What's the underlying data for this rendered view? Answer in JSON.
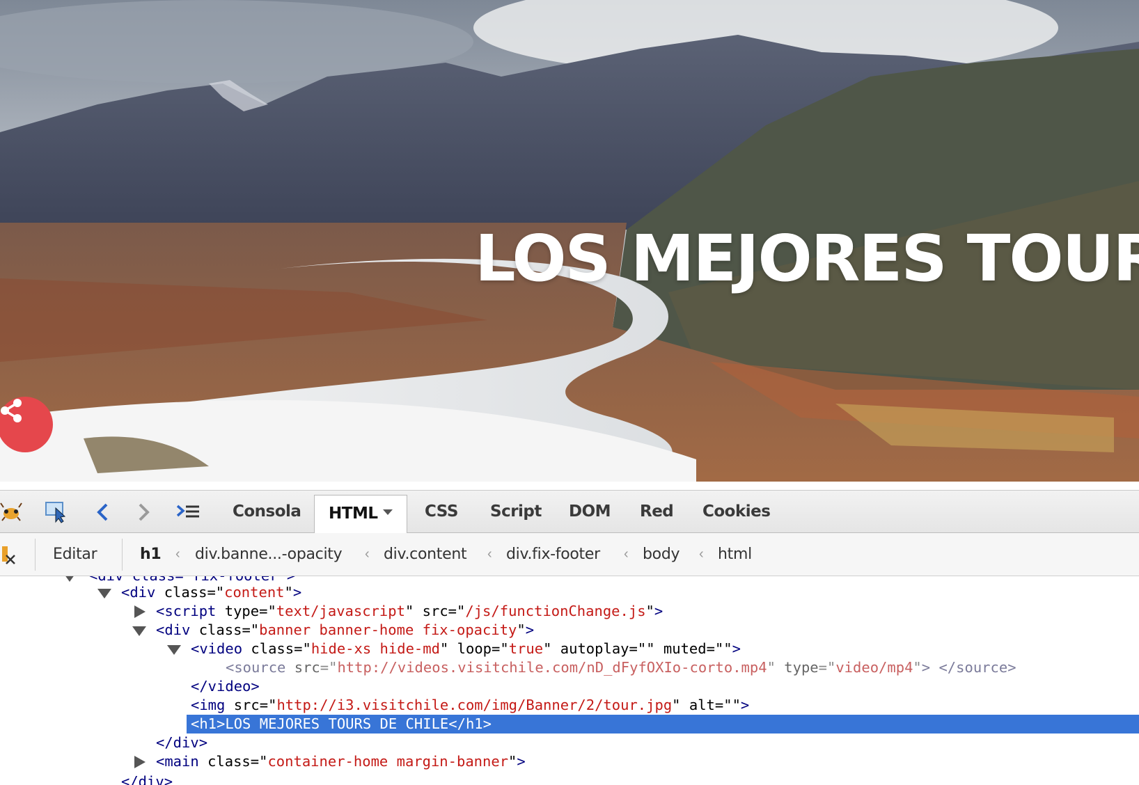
{
  "banner": {
    "title": "LOS MEJORES TOUR",
    "share_icon": "share-icon",
    "accent_color": "#e5474c"
  },
  "devtools": {
    "toolbar": {
      "icons": [
        "firebug-icon",
        "inspect-pointer-icon",
        "back-icon",
        "forward-icon",
        "command-line-icon"
      ],
      "tabs": [
        {
          "label": "Consola",
          "active": false
        },
        {
          "label": "HTML",
          "active": true
        },
        {
          "label": "CSS",
          "active": false
        },
        {
          "label": "Script",
          "active": false
        },
        {
          "label": "DOM",
          "active": false
        },
        {
          "label": "Red",
          "active": false
        },
        {
          "label": "Cookies",
          "active": false
        }
      ]
    },
    "breadcrumbs": {
      "edit_label": "Editar",
      "items": [
        "h1",
        "div.banne...-opacity",
        "div.content",
        "div.fix-footer",
        "body",
        "html"
      ]
    },
    "tree": {
      "partial_top": "<div class=\"fix-footer\">",
      "lines": [
        {
          "tag_open": "<div",
          "attrs": [
            {
              "n": "class",
              "v": "content"
            }
          ],
          "close": ">"
        },
        {
          "tag_open": "<script",
          "attrs": [
            {
              "n": "type",
              "v": "text/javascript"
            },
            {
              "n": "src",
              "v": "/js/functionChange.js"
            }
          ],
          "close": ">"
        },
        {
          "tag_open": "<div",
          "attrs": [
            {
              "n": "class",
              "v": "banner banner-home fix-opacity"
            }
          ],
          "close": ">"
        },
        {
          "tag_open": "<video",
          "attrs": [
            {
              "n": "class",
              "v": "hide-xs hide-md"
            },
            {
              "n": "loop",
              "v": "true"
            },
            {
              "n": "autoplay",
              "v": ""
            },
            {
              "n": "muted",
              "v": ""
            }
          ],
          "close": ">"
        },
        {
          "tag_open": "<source",
          "attrs": [
            {
              "n": "src",
              "v": "http://videos.visitchile.com/nD_dFyfOXIo-corto.mp4"
            },
            {
              "n": "type",
              "v": "video/mp4"
            }
          ],
          "close": ">",
          "end": "</source>"
        },
        {
          "end_tag": "</video>"
        },
        {
          "tag_open": "<img",
          "attrs": [
            {
              "n": "src",
              "v": "http://i3.visitchile.com/img/Banner/2/tour.jpg"
            },
            {
              "n": "alt",
              "v": ""
            }
          ],
          "close": ">"
        },
        {
          "selected_text": "LOS MEJORES TOURS DE CHILE",
          "open": "<h1>",
          "end": "</h1>"
        },
        {
          "end_tag": "</div>"
        },
        {
          "tag_open": "<main",
          "attrs": [
            {
              "n": "class",
              "v": "container-home margin-banner"
            }
          ],
          "close": ">"
        },
        {
          "partial_bottom": "</div>"
        }
      ]
    },
    "colors": {
      "selection": "#3875d7",
      "tag": "#00007f",
      "value": "#c41a16"
    }
  }
}
